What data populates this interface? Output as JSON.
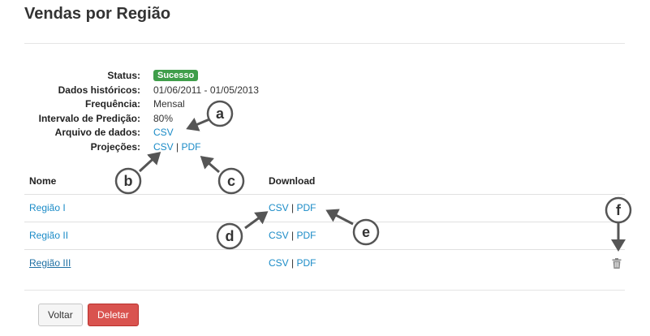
{
  "page": {
    "title": "Vendas por Região"
  },
  "details": {
    "status_label": "Status:",
    "status_value": "Sucesso",
    "historical_label": "Dados históricos:",
    "historical_value": "01/06/2011 - 01/05/2013",
    "frequency_label": "Frequência:",
    "frequency_value": "Mensal",
    "interval_label": "Intervalo de Predição:",
    "interval_value": "80%",
    "datafile_label": "Arquivo de dados:",
    "datafile_csv": "CSV",
    "projections_label": "Projeções:",
    "projections_csv": "CSV",
    "projections_pdf": "PDF",
    "separator": "|"
  },
  "table": {
    "headers": {
      "name": "Nome",
      "download": "Download"
    },
    "rows": [
      {
        "name": "Região I",
        "csv": "CSV",
        "pdf": "PDF"
      },
      {
        "name": "Região II",
        "csv": "CSV",
        "pdf": "PDF"
      },
      {
        "name": "Região III",
        "csv": "CSV",
        "pdf": "PDF"
      }
    ]
  },
  "buttons": {
    "back": "Voltar",
    "delete": "Deletar"
  },
  "annotations": [
    "a",
    "b",
    "c",
    "d",
    "e",
    "f"
  ],
  "colors": {
    "link": "#1a8bc7",
    "success": "#3f9e4a",
    "danger": "#d9534f"
  }
}
